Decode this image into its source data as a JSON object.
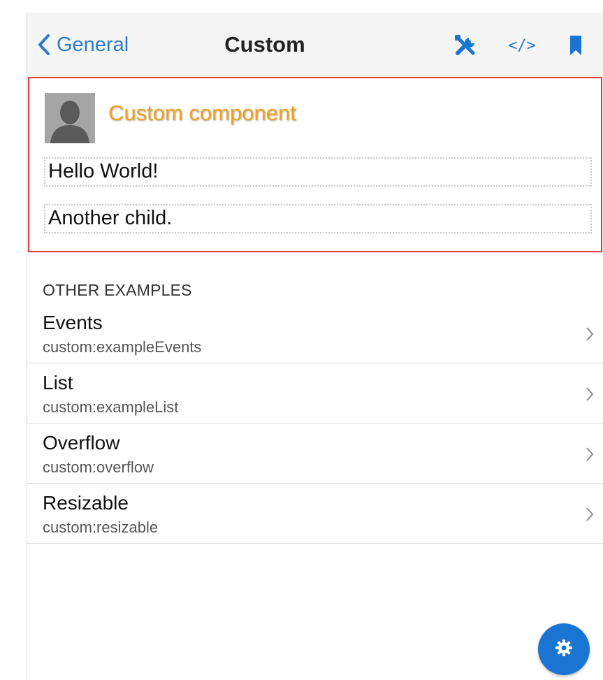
{
  "header": {
    "back_label": "General",
    "title": "Custom",
    "icons": [
      "tools-icon",
      "code-icon",
      "bookmark-icon"
    ]
  },
  "custom_component": {
    "title": "Custom component",
    "children": [
      "Hello World!",
      "Another child."
    ]
  },
  "other_examples": {
    "section_title": "OTHER EXAMPLES",
    "items": [
      {
        "title": "Events",
        "subtitle": "custom:exampleEvents"
      },
      {
        "title": "List",
        "subtitle": "custom:exampleList"
      },
      {
        "title": "Overflow",
        "subtitle": "custom:overflow"
      },
      {
        "title": "Resizable",
        "subtitle": "custom:resizable"
      }
    ]
  },
  "colors": {
    "accent": "#1a74d2",
    "component_title": "#f0a11c",
    "component_border": "#e53935"
  },
  "code_glyph": "</>"
}
